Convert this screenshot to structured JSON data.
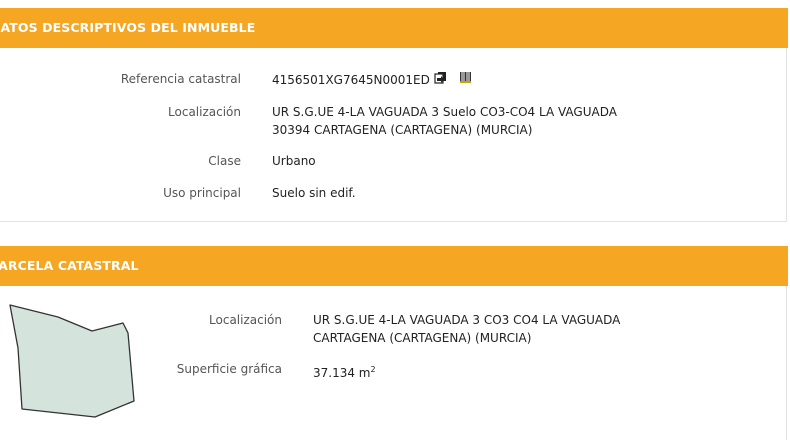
{
  "section1": {
    "title": "DATOS DESCRIPTIVOS DEL INMUEBLE",
    "rows": [
      {
        "label": "Referencia catastral",
        "value": "4156501XG7645N0001ED"
      },
      {
        "label": "Localización",
        "value_line1": "UR S.G.UE 4-LA VAGUADA 3 Suelo CO3-CO4 LA VAGUADA",
        "value_line2": "30394 CARTAGENA (CARTAGENA) (MURCIA)"
      },
      {
        "label": "Clase",
        "value": "Urbano"
      },
      {
        "label": "Uso principal",
        "value": "Suelo sin edif."
      }
    ],
    "icons": [
      "copy-reference-icon",
      "barcode-icon"
    ]
  },
  "section2": {
    "title": "PARCELA CATASTRAL",
    "rows": [
      {
        "label": "Localización",
        "value_line1": "UR S.G.UE 4-LA VAGUADA 3 CO3 CO4 LA VAGUADA",
        "value_line2": "CARTAGENA (CARTAGENA) (MURCIA)"
      },
      {
        "label": "Superficie gráfica",
        "value": "37.134 m",
        "unit_sup": "2"
      }
    ],
    "parcel_icon": "parcel-outline-icon"
  },
  "colors": {
    "header_bg": "#f5a623",
    "header_text": "#ffffff",
    "parcel_fill": "#d4e4dc"
  }
}
